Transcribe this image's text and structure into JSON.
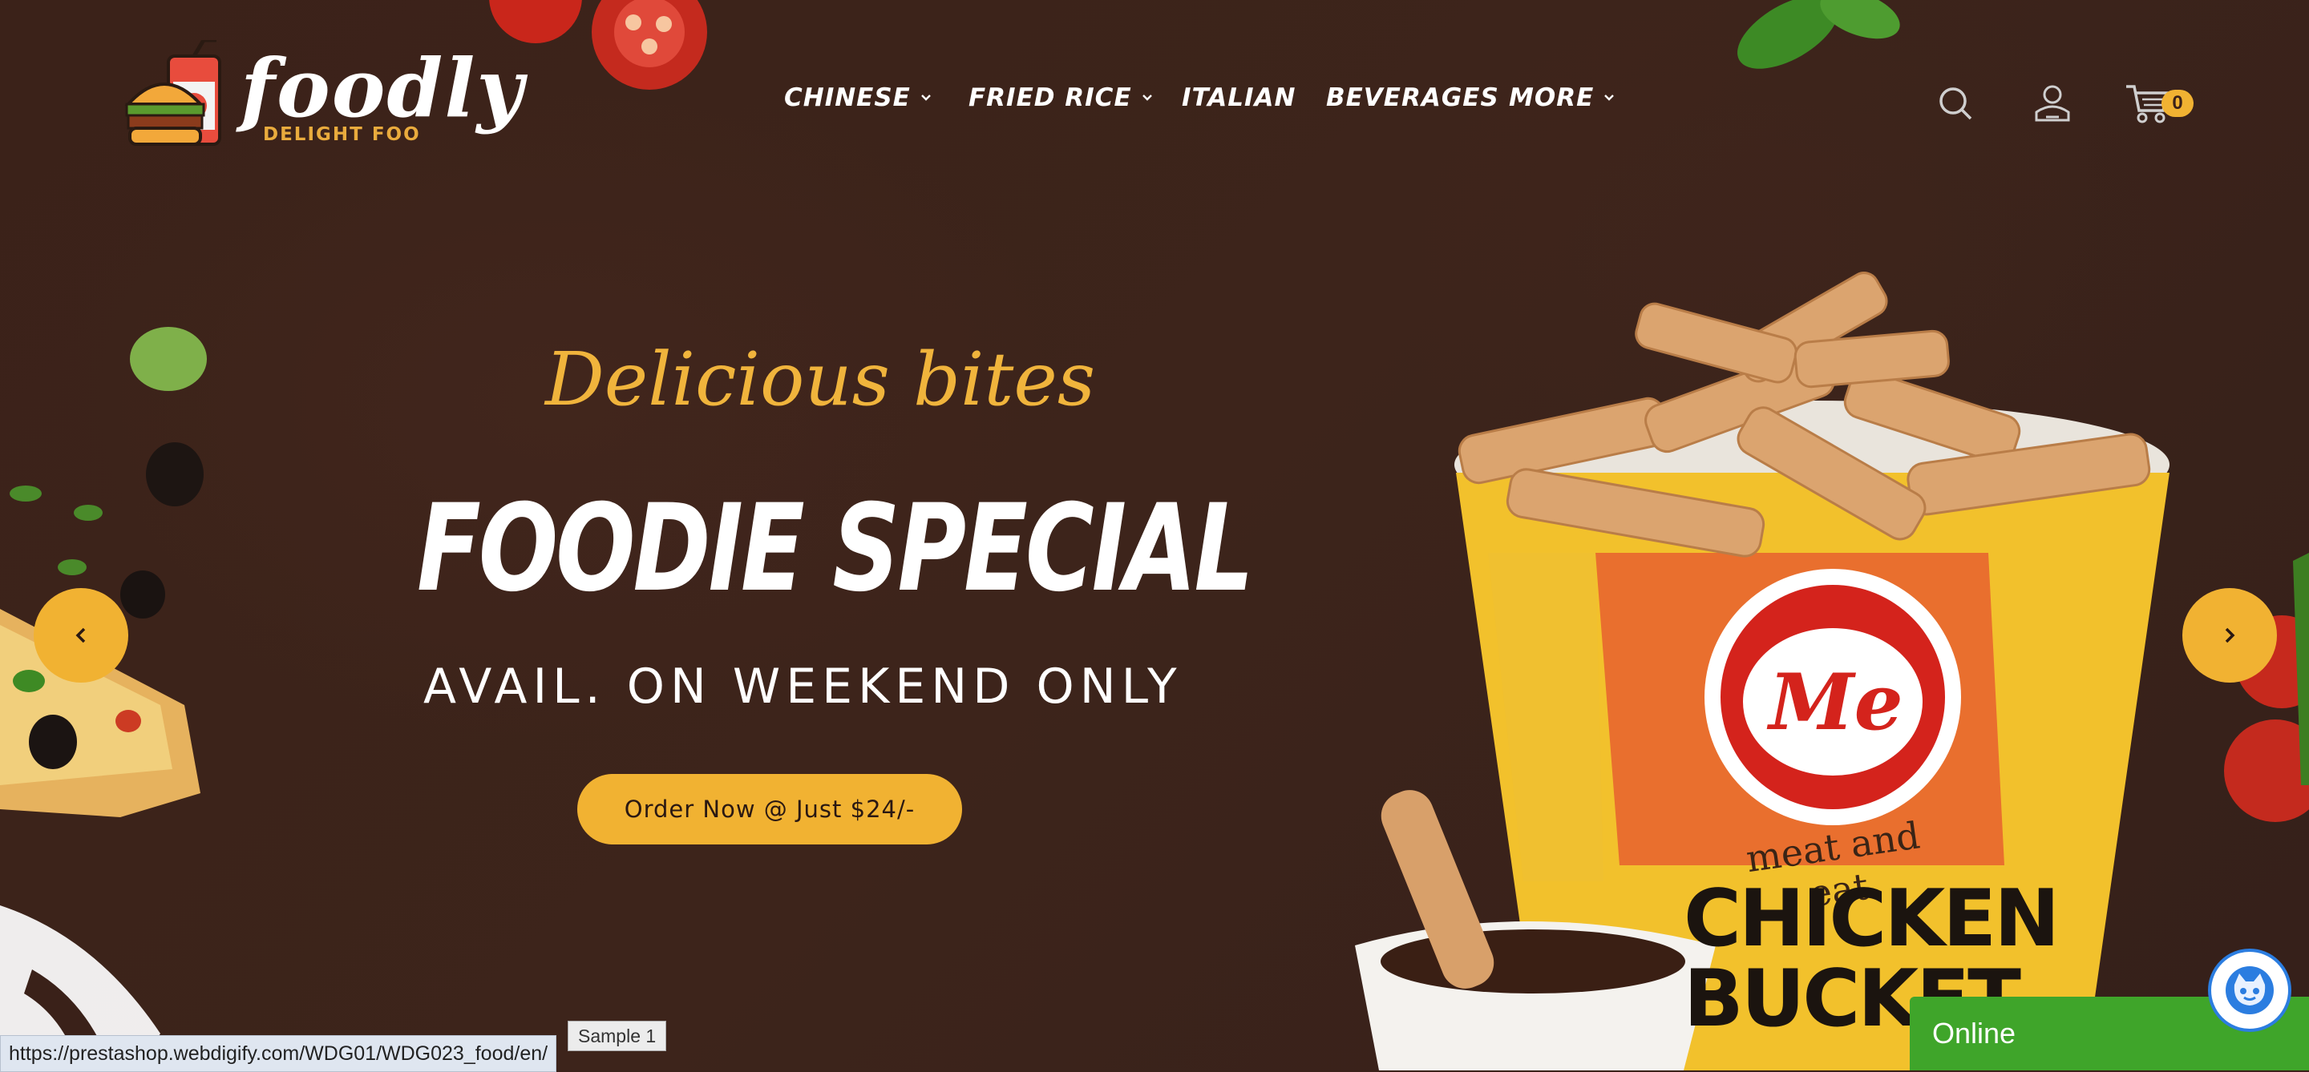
{
  "brand": {
    "name": "foodly",
    "tagline": "DELIGHT FOO"
  },
  "nav": {
    "items": [
      {
        "label": "CHINESE",
        "has_dropdown": true
      },
      {
        "label": "FRIED RICE",
        "has_dropdown": true
      },
      {
        "label": "ITALIAN",
        "has_dropdown": false
      },
      {
        "label": "BEVERAGES",
        "has_dropdown": false
      },
      {
        "label": "MORE",
        "has_dropdown": true
      }
    ]
  },
  "header_icons": {
    "search": "search-icon",
    "account": "user-icon",
    "cart": "cart-icon",
    "cart_count": "0"
  },
  "hero": {
    "script_heading": "Delicious bites",
    "title": "FOODIE SPECIAL",
    "subtitle": "AVAIL. ON WEEKEND ONLY",
    "cta_label": "Order Now @ Just $24/-",
    "product_brand": "Me",
    "product_tagline": "meat and eat",
    "product_name_line1": "CHICKEN",
    "product_name_line2": "BUCKET"
  },
  "carousel": {
    "prev_icon": "chevron-left-icon",
    "next_icon": "chevron-right-icon"
  },
  "status_bar": {
    "url": "https://prestashop.webdigify.com/WDG01/WDG023_food/en/",
    "sample_label": "Sample 1"
  },
  "chat": {
    "status": "Online"
  },
  "colors": {
    "background": "#3a2119",
    "accent": "#f1b232",
    "online_green": "#3fa52a"
  }
}
